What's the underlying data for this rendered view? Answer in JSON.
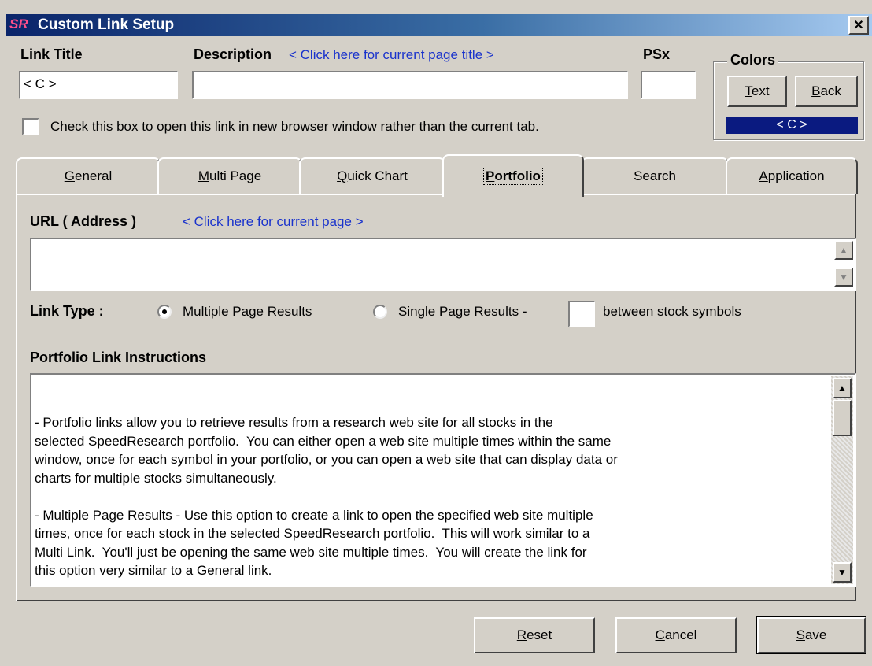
{
  "window": {
    "title": "Custom Link Setup",
    "close_glyph": "✕",
    "app_icon_text": "SR"
  },
  "fields": {
    "link_title_label": "Link Title",
    "link_title_value": "< C >",
    "description_label": "Description",
    "description_link": "< Click here for current page title >",
    "description_value": "",
    "psx_label": "PSx",
    "psx_value": ""
  },
  "colors": {
    "group_label": "Colors",
    "text_button": "Text",
    "back_button": "Back",
    "preview_text": "< C >",
    "preview_bg": "#0a1a80",
    "preview_fg": "#ffffff"
  },
  "new_window_checkbox": {
    "label": "Check this box to open this link in new browser window rather than the current tab.",
    "checked": false
  },
  "tabs": [
    {
      "label": "General"
    },
    {
      "label": "Multi Page"
    },
    {
      "label": "Quick Chart"
    },
    {
      "label": "Portfolio"
    },
    {
      "label": "Search"
    },
    {
      "label": "Application"
    }
  ],
  "portfolio": {
    "url_label": "URL ( Address )",
    "url_link": "< Click here for current page >",
    "url_value": "",
    "link_type_label": "Link Type :",
    "option_multiple": "Multiple Page Results",
    "option_single": "Single Page Results -",
    "separator_value": "",
    "between_label": "between stock symbols",
    "instructions_label": "Portfolio Link Instructions",
    "instructions_text": "- Portfolio links allow you to retrieve results from a research web site for all stocks in the\nselected SpeedResearch portfolio.  You can either open a web site multiple times within the same\nwindow, once for each symbol in your portfolio, or you can open a web site that can display data or\ncharts for multiple stocks simultaneously.\n\n- Multiple Page Results - Use this option to create a link to open the specified web site multiple\ntimes, once for each stock in the selected SpeedResearch portfolio.  This will work similar to a\nMulti Link.  You'll just be opening the same web site multiple times.  You will create the link for\nthis option very similar to a General link."
  },
  "buttons": {
    "reset": "Reset",
    "cancel": "Cancel",
    "save": "Save"
  }
}
